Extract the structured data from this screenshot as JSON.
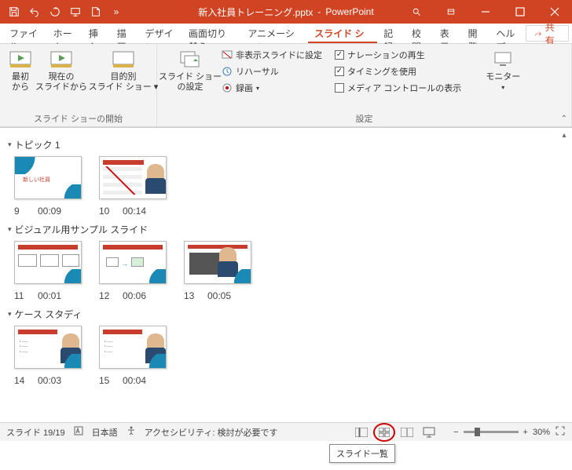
{
  "titlebar": {
    "filename": "新入社員トレーニング.pptx",
    "appname": "PowerPoint",
    "qat_more": "»"
  },
  "tabs": {
    "items": [
      "ファイル",
      "ホーム",
      "挿入",
      "描画",
      "デザイン",
      "画面切り替え",
      "アニメーション",
      "スライド ショー",
      "記録",
      "校閲",
      "表示",
      "開発",
      "ヘルプ"
    ],
    "active_index": 7,
    "share": "共有"
  },
  "ribbon": {
    "group_start": {
      "label": "スライド ショーの開始",
      "from_beginning": "最初から",
      "from_current": "現在の\nスライドから",
      "custom": "目的別\nスライド ショー"
    },
    "group_setup": {
      "label": "設定",
      "setup_show": "スライド ショー\nの設定",
      "hide_slide": "非表示スライドに設定",
      "rehearse": "リハーサル",
      "record": "録画",
      "play_narrations": "ナレーションの再生",
      "use_timings": "タイミングを使用",
      "show_media": "メディア コントロールの表示",
      "monitor": "モニター"
    }
  },
  "sections": [
    {
      "title": "トピック 1",
      "slides": [
        {
          "num": "9",
          "time": "00:09",
          "style": "accent"
        },
        {
          "num": "10",
          "time": "00:14",
          "style": "chart_person"
        }
      ]
    },
    {
      "title": "ビジュアル用サンプル スライド",
      "slides": [
        {
          "num": "11",
          "time": "00:01",
          "style": "cards"
        },
        {
          "num": "12",
          "time": "00:06",
          "style": "flow"
        },
        {
          "num": "13",
          "time": "00:05",
          "style": "person2"
        }
      ]
    },
    {
      "title": "ケース スタディ",
      "slides": [
        {
          "num": "14",
          "time": "00:03",
          "style": "bullets_person"
        },
        {
          "num": "15",
          "time": "00:04",
          "style": "bullets_person"
        }
      ]
    }
  ],
  "statusbar": {
    "slide_counter": "スライド 19/19",
    "language": "日本語",
    "accessibility": "アクセシビリティ: 検討が必要です",
    "zoom_pct": "30%",
    "tooltip": "スライド一覧"
  }
}
